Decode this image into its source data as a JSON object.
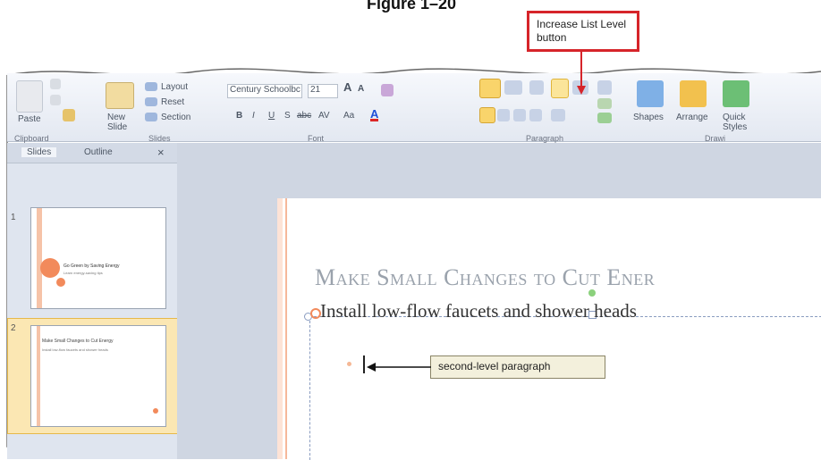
{
  "figure": {
    "caption": "Figure 1–20"
  },
  "callouts": {
    "increase_list_level": "Increase List Level button",
    "second_level": "second-level paragraph"
  },
  "ribbon": {
    "clipboard": {
      "paste": "Paste",
      "group": "Clipboard"
    },
    "slides": {
      "new_slide": "New Slide",
      "layout": "Layout",
      "reset": "Reset",
      "section": "Section",
      "group": "Slides"
    },
    "font": {
      "family": "Century Schoolbc",
      "size": "21",
      "bold": "B",
      "italic": "I",
      "underline": "U",
      "shadow": "S",
      "strike": "abc",
      "spacing": "AV",
      "case": "Aa",
      "color": "A",
      "grow": "A",
      "shrink": "A",
      "group": "Font"
    },
    "paragraph": {
      "group": "Paragraph"
    },
    "drawing": {
      "shapes": "Shapes",
      "arrange": "Arrange",
      "quick_styles": "Quick Styles",
      "group": "Drawi"
    }
  },
  "pane": {
    "tabs": [
      "Slides",
      "Outline"
    ],
    "close": "×",
    "thumbs": [
      {
        "number": "1",
        "title": "Go Green by Saving Energy",
        "subtitle": "Learn energy-saving tips"
      },
      {
        "number": "2",
        "title": "Make Small Changes to Cut Energy",
        "subtitle": "Install low-flow faucets and shower heads"
      }
    ]
  },
  "slide": {
    "title": "Make Small Changes to Cut Ener",
    "bullet1": "Install low-flow faucets and shower heads"
  },
  "colors": {
    "accent": "#f28a5b",
    "callout_border": "#d6242a",
    "selection": "#f9c74f"
  }
}
